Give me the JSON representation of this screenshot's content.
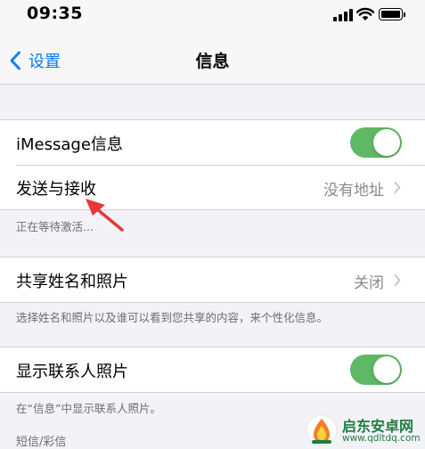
{
  "status_bar": {
    "time": "09:35"
  },
  "nav": {
    "back_label": "设置",
    "title": "信息"
  },
  "sections": [
    {
      "rows": [
        {
          "label": "iMessage信息",
          "toggle_on": true
        },
        {
          "label": "发送与接收",
          "value": "没有地址"
        }
      ],
      "footer": "正在等待激活..."
    },
    {
      "rows": [
        {
          "label": "共享姓名和照片",
          "value": "关闭"
        }
      ],
      "footer": "选择姓名和照片以及谁可以看到您共享的内容，来个性化信息。"
    },
    {
      "rows": [
        {
          "label": "显示联系人照片",
          "toggle_on": true
        }
      ],
      "footer": "在“信息”中显示联系人照片。"
    }
  ],
  "section_header_sms": "短信/彩信",
  "watermark": {
    "title": "启东安卓网",
    "url": "www.qdltdq.com"
  },
  "colors": {
    "accent": "#0a7aff",
    "toggle_on": "#5fb865",
    "annotation_arrow": "#e53935",
    "watermark": "#1f7c42"
  }
}
